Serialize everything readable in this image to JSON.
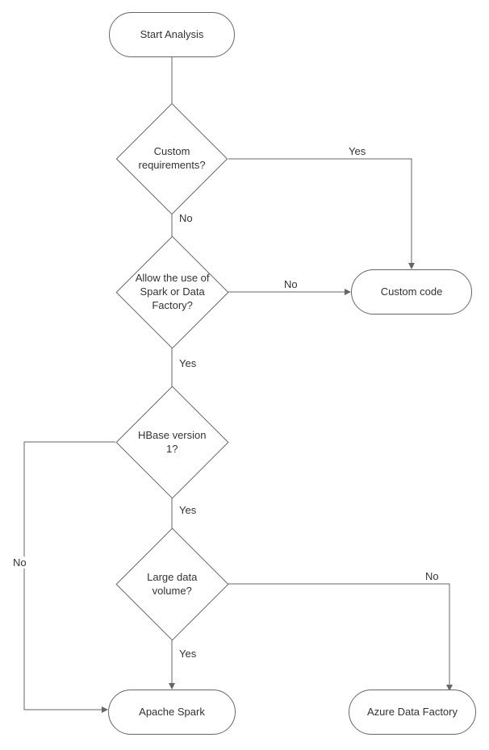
{
  "chart_data": {
    "type": "flowchart",
    "nodes": [
      {
        "id": "start",
        "type": "terminator",
        "label": "Start Analysis"
      },
      {
        "id": "custom_req",
        "type": "decision",
        "label": "Custom requirements?"
      },
      {
        "id": "allow_spark",
        "type": "decision",
        "label": "Allow the use of Spark or Data Factory?"
      },
      {
        "id": "hbase_v1",
        "type": "decision",
        "label": "HBase version 1?"
      },
      {
        "id": "large_data",
        "type": "decision",
        "label": "Large data volume?"
      },
      {
        "id": "custom_code",
        "type": "terminator",
        "label": "Custom code"
      },
      {
        "id": "apache_spark",
        "type": "terminator",
        "label": "Apache Spark"
      },
      {
        "id": "azure_df",
        "type": "terminator",
        "label": "Azure Data Factory"
      }
    ],
    "edges": [
      {
        "from": "start",
        "to": "custom_req",
        "label": ""
      },
      {
        "from": "custom_req",
        "to": "custom_code",
        "label": "Yes"
      },
      {
        "from": "custom_req",
        "to": "allow_spark",
        "label": "No"
      },
      {
        "from": "allow_spark",
        "to": "custom_code",
        "label": "No"
      },
      {
        "from": "allow_spark",
        "to": "hbase_v1",
        "label": "Yes"
      },
      {
        "from": "hbase_v1",
        "to": "apache_spark",
        "label": "No"
      },
      {
        "from": "hbase_v1",
        "to": "large_data",
        "label": "Yes"
      },
      {
        "from": "large_data",
        "to": "azure_df",
        "label": "No"
      },
      {
        "from": "large_data",
        "to": "apache_spark",
        "label": "Yes"
      }
    ]
  },
  "labels": {
    "start": "Start Analysis",
    "custom_req": "Custom requirements?",
    "allow_spark": "Allow the use of Spark or Data Factory?",
    "hbase_v1": "HBase version 1?",
    "large_data": "Large data volume?",
    "custom_code": "Custom code",
    "apache_spark": "Apache Spark",
    "azure_df": "Azure Data Factory",
    "yes": "Yes",
    "no": "No"
  }
}
